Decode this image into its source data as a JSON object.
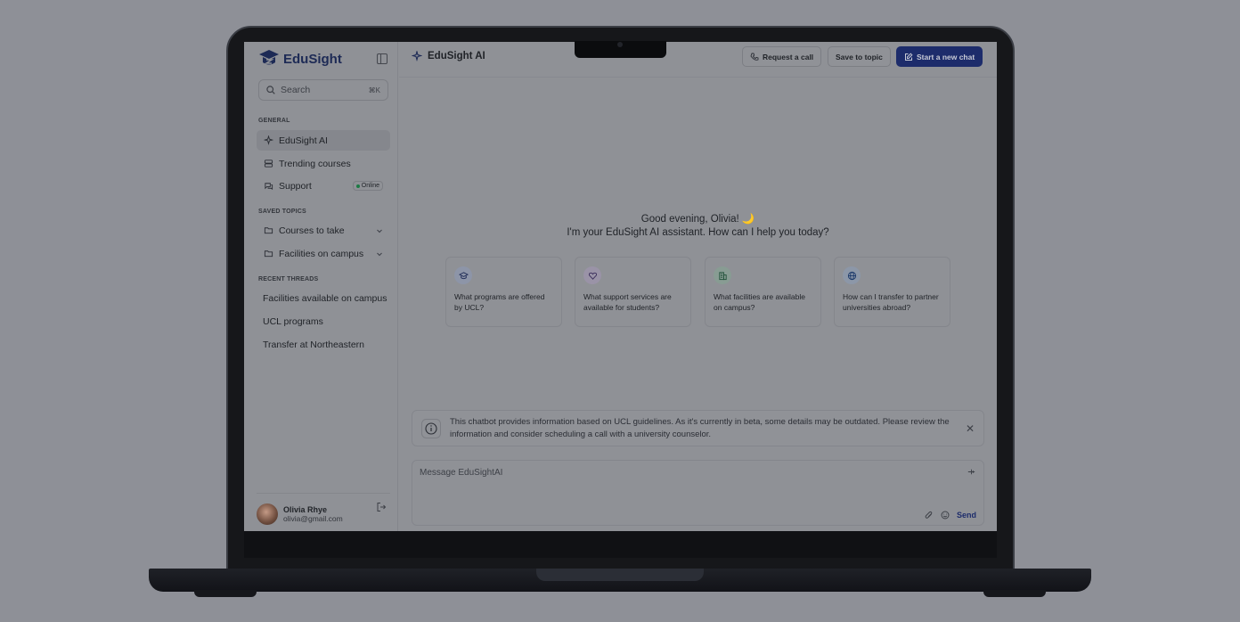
{
  "app": {
    "name": "EduSight",
    "search_placeholder": "Search",
    "search_shortcut": "⌘K"
  },
  "sidebar": {
    "general_label": "GENERAL",
    "general": [
      {
        "label": "EduSight AI",
        "icon": "sparkle-icon",
        "active": true
      },
      {
        "label": "Trending courses",
        "icon": "stack-icon"
      },
      {
        "label": "Support",
        "icon": "chat-bubbles-icon",
        "badge": "Online"
      }
    ],
    "saved_label": "SAVED TOPICS",
    "saved": [
      {
        "label": "Courses to take",
        "icon": "folder-icon"
      },
      {
        "label": "Facilities on campus",
        "icon": "folder-icon"
      }
    ],
    "recent_label": "RECENT THREADS",
    "recent": [
      "Facilities available on campus",
      "UCL programs",
      "Transfer at Northeastern"
    ],
    "user": {
      "name": "Olivia Rhye",
      "email": "olivia@gmail.com"
    }
  },
  "header": {
    "title": "EduSight AI",
    "request_call": "Request a call",
    "save_topic": "Save to topic",
    "new_chat": "Start a new chat"
  },
  "greeting": {
    "line1": "Good evening, Olivia! 🌙",
    "line2": "I'm your EduSight AI assistant. How can I help you today?"
  },
  "suggestions": [
    {
      "text": "What programs are offered by UCL?",
      "icon": "graduation-cap-icon",
      "tint": "#8d95a8"
    },
    {
      "text": "What support services are available for students?",
      "icon": "heart-hand-icon",
      "tint": "#9a93a7"
    },
    {
      "text": "What facilities are available on campus?",
      "icon": "building-icon",
      "tint": "#889c93"
    },
    {
      "text": "How can I transfer to partner universities abroad?",
      "icon": "globe-icon",
      "tint": "#8c97a8"
    }
  ],
  "notice": {
    "text": "This chatbot provides information based on UCL guidelines. As it's currently in beta, some details may be outdated. Please review the information and consider scheduling a call with a university counselor."
  },
  "composer": {
    "placeholder": "Message EduSightAI",
    "send_label": "Send"
  },
  "colors": {
    "brand": "#1d2c6b",
    "online": "#1c7a44"
  }
}
